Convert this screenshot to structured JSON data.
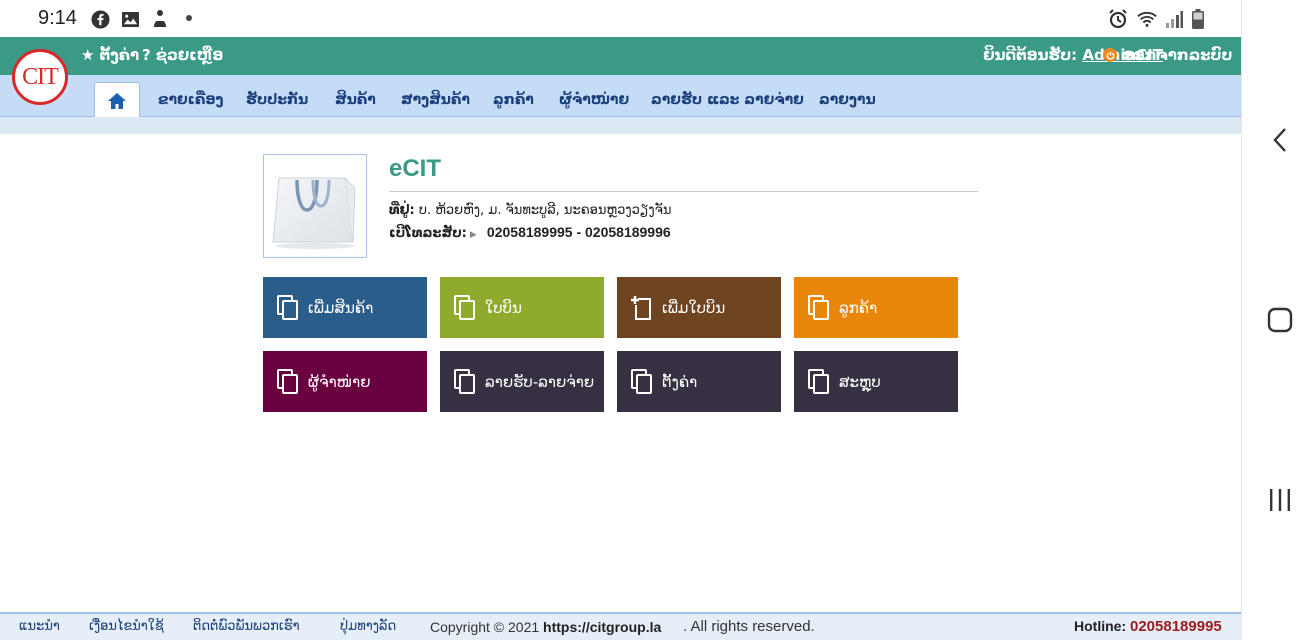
{
  "status_bar": {
    "time": "9:14",
    "icons": [
      "facebook-icon",
      "image-icon",
      "notification-icon",
      "alarm-icon",
      "wifi-icon",
      "signal-icon",
      "battery-icon"
    ]
  },
  "header": {
    "logo_text": "CIT",
    "settings_label": "★ ຕັ້ງຄ່າ",
    "help_label": "? ຊ່ວຍເຫຼືອ",
    "welcome_label": "ຍິນດີຕ້ອນຮັບ:",
    "username": "AdminCIT",
    "logout_label": "ອອກຈາກລະບົບ",
    "accent": "#3a9a86"
  },
  "nav": {
    "items": [
      {
        "label": "ຂາຍເຄື່ອງ"
      },
      {
        "label": "ຮັບປະກັນ"
      },
      {
        "label": "ສິນຄ້າ"
      },
      {
        "label": "ສາງສິນຄ້າ"
      },
      {
        "label": "ລູກຄ້າ"
      },
      {
        "label": "ຜູ້ຈຳໜ່າຍ"
      },
      {
        "label": "ລາຍຮັບ ແລະ ລາຍຈ່າຍ"
      },
      {
        "label": "ລາຍງານ"
      }
    ]
  },
  "company": {
    "name": "eCIT",
    "address_label": "ທີ່ຢູ່:",
    "address": "ບ. ຫ້ວຍຫົງ, ມ. ຈັນທະບູລີ, ນະຄອນຫຼວງວຽງຈັນ",
    "phone_label": "ເບີໂທລະສັບ:",
    "phone": "02058189995 - 02058189996"
  },
  "tiles": [
    {
      "label": "ເພີ່ມສິນຄ້າ",
      "color": "#2b5d8b"
    },
    {
      "label": "ໃບບິນ",
      "color": "#8fab2e"
    },
    {
      "label": "ເພີ່ມໃບບິນ",
      "color": "#6f4421"
    },
    {
      "label": "ລູກຄ້າ",
      "color": "#e8870a"
    },
    {
      "label": "ຜູ້ຈຳໜ່າຍ",
      "color": "#6b0040"
    },
    {
      "label": "ລາຍຮັບ-ລາຍຈ່າຍ",
      "color": "#363042"
    },
    {
      "label": "ຕັ້ງຄ່າ",
      "color": "#363042"
    },
    {
      "label": "ສະຫຼຸບ",
      "color": "#363042"
    }
  ],
  "footer": {
    "links": [
      {
        "label": "ແນະນຳ"
      },
      {
        "label": "ເງື່ອນໄຂນຳໃຊ້"
      },
      {
        "label": "ຕິດຕໍ່ພົວພັນພວກເຮົາ"
      },
      {
        "label": "ປຸ່ມທາງລັດ"
      }
    ],
    "copyright": "Copyright © 2021",
    "site": "https://citgroup.la",
    "rights": ". All rights reserved.",
    "hotline_label": "Hotline:",
    "hotline_number": "02058189995"
  }
}
